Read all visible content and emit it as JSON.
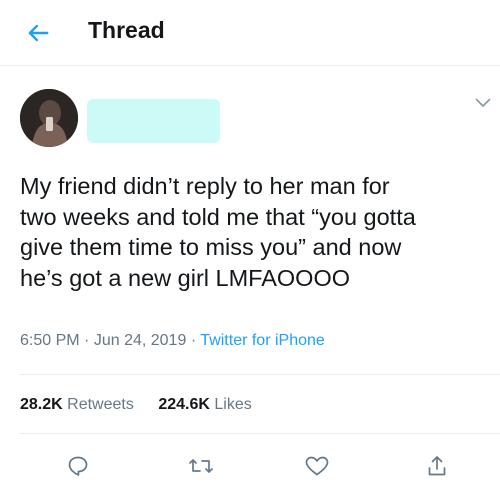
{
  "header": {
    "back_icon": "arrow-left-icon",
    "title": "Thread",
    "accent_color": "#1da1f2"
  },
  "tweet": {
    "author_name_redacted": true,
    "text_lines": [
      "My friend didn’t reply to her man for",
      "two weeks and told me that “you gotta",
      "give them time to miss you” and now",
      "he’s got a new girl LMFAOOOO"
    ],
    "time": "6:50 PM",
    "separator": "·",
    "date": "Jun 24, 2019",
    "source": "Twitter for iPhone",
    "retweets_count": "28.2K",
    "retweets_label": "Retweets",
    "likes_count": "224.6K",
    "likes_label": "Likes"
  },
  "actions": [
    "reply-icon",
    "retweet-icon",
    "like-icon",
    "share-icon"
  ],
  "colors": {
    "text": "#14171a",
    "secondary": "#657786",
    "divider": "#e6ecf0",
    "icon": "#657786",
    "redaction": "#ccfbf7"
  }
}
